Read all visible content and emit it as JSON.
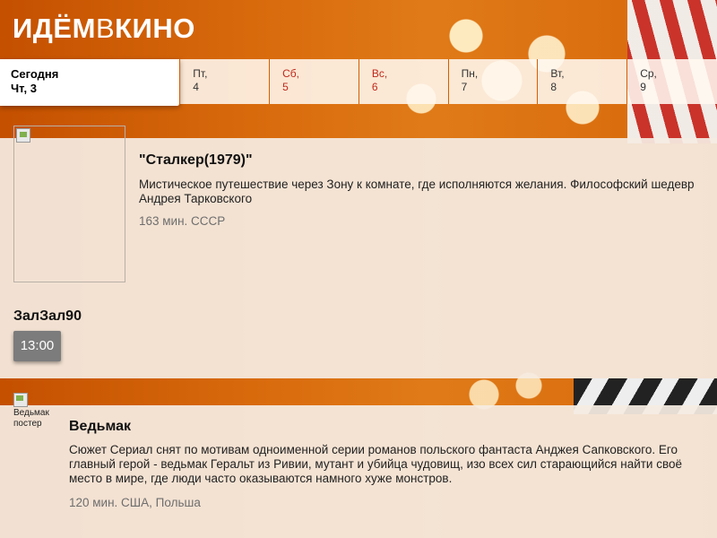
{
  "header": {
    "logo_part1": "ИДЁМ",
    "logo_part2": "В",
    "logo_part3": "КИНО"
  },
  "days": [
    {
      "label": "Сегодня",
      "sub": "Чт, 3",
      "active": true,
      "weekend": false
    },
    {
      "label": "Пт,",
      "sub": "4",
      "active": false,
      "weekend": false
    },
    {
      "label": "Сб,",
      "sub": "5",
      "active": false,
      "weekend": true
    },
    {
      "label": "Вс,",
      "sub": "6",
      "active": false,
      "weekend": true
    },
    {
      "label": "Пн,",
      "sub": "7",
      "active": false,
      "weekend": false
    },
    {
      "label": "Вт,",
      "sub": "8",
      "active": false,
      "weekend": false
    },
    {
      "label": "Ср,",
      "sub": "9",
      "active": false,
      "weekend": false
    }
  ],
  "movies": [
    {
      "title": "\"Сталкер(1979)\"",
      "description": "Мистическое путешествие через Зону к комнате, где исполняются желания. Философский шедевр Андрея Тарковского",
      "meta": "163 мин. СССР",
      "hall": "ЗалЗал90",
      "times": [
        "13:00"
      ]
    },
    {
      "title": "Ведьмак",
      "poster_alt": "Ведьмак постер",
      "description": "Сюжет Сериал снят по мотивам одноименной серии романов польского фантаста Анджея Сапковского. Его главный герой - ведьмак Геральт из Ривии, мутант и убийца чудовищ, изо всех сил старающийся найти своё место в мире, где люди часто оказываются намного хуже монстров.",
      "meta": "120 мин. США, Польша"
    }
  ],
  "colors": {
    "accent": "#d35e00",
    "weekend": "#c0291d",
    "time_button": "#7c7c7c"
  }
}
